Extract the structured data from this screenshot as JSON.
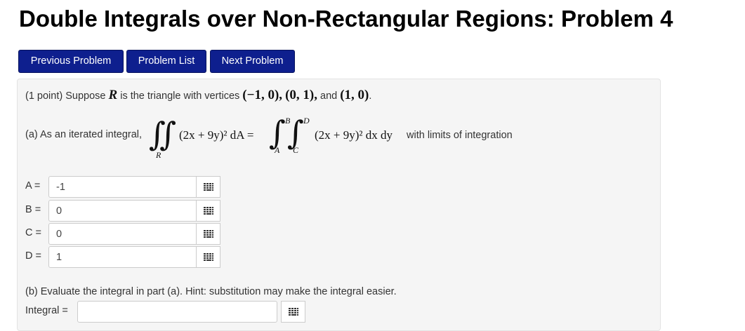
{
  "page_title": "Double Integrals over Non-Rectangular Regions: Problem 4",
  "nav": {
    "previous": "Previous Problem",
    "list": "Problem List",
    "next": "Next Problem"
  },
  "problem": {
    "points": "(1 point) Suppose",
    "region_var": "R",
    "is_triangle": "is the triangle with vertices",
    "vertex1": "(−1, 0),",
    "vertex2": "(0, 1),",
    "and": "and",
    "vertex3": "(1, 0)",
    "period": "."
  },
  "part_a": {
    "prefix": "(a) As an iterated integral,",
    "integrand": "(2x + 9y)² dA =",
    "integrand2": "(2x + 9y)² dx dy",
    "suffix": "with limits of integration",
    "region": "R",
    "limits": {
      "lower_outer": "A",
      "upper_outer": "B",
      "lower_inner": "C",
      "upper_inner": "D"
    }
  },
  "answers": [
    {
      "label": "A =",
      "value": "-1"
    },
    {
      "label": "B =",
      "value": "0"
    },
    {
      "label": "C =",
      "value": "0"
    },
    {
      "label": "D =",
      "value": "1"
    }
  ],
  "part_b": {
    "text": "(b) Evaluate the integral in part (a). Hint: substitution may make the integral easier.",
    "label": "Integral =",
    "value": ""
  },
  "colors": {
    "button": "#0e1f8e",
    "panel": "#f5f5f5",
    "panel_border": "#e3e3e3"
  },
  "icons": {
    "equation_editor": "keypad-icon"
  }
}
